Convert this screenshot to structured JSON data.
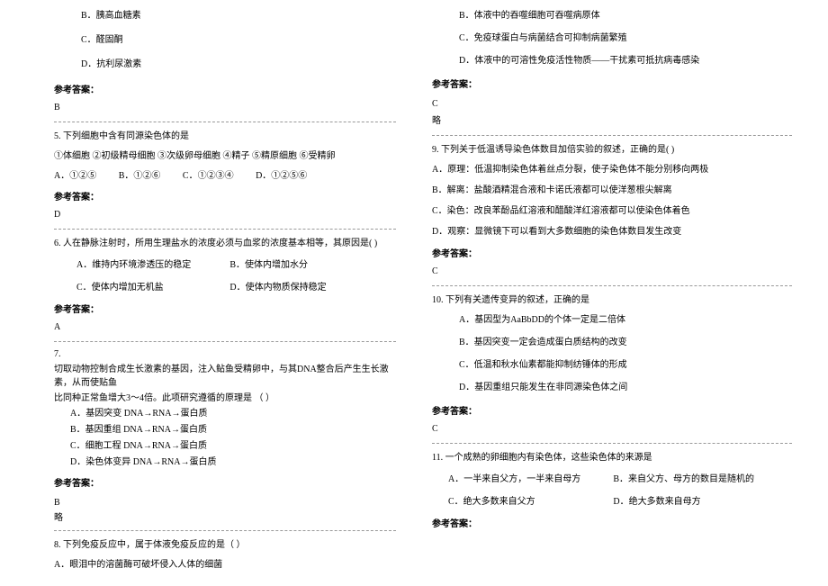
{
  "left": {
    "q4": {
      "optB": "B．胰高血糖素",
      "optC": "C．醛固酮",
      "optD": "D．抗利尿激素",
      "answerLabel": "参考答案：",
      "answer": "B"
    },
    "q5": {
      "stem": "5. 下列细胞中含有同源染色体的是",
      "items": "①体细胞  ②初级精母细胞  ③次级卵母细胞  ④精子  ⑤精原细胞  ⑥受精卵",
      "optA": "A．①②⑤",
      "optB": "B．①②⑥",
      "optC": "C．①②③④",
      "optD": "D．①②⑤⑥",
      "answerLabel": "参考答案：",
      "answer": "D"
    },
    "q6": {
      "stem": "6. 人在静脉注射时，所用生理盐水的浓度必须与血浆的浓度基本相等，其原因是(    )",
      "optA": "A．维持内环境渗透压的稳定",
      "optB": "B．使体内增加水分",
      "optC": "C．使体内增加无机盐",
      "optD": "D．使体内物质保持稳定",
      "answerLabel": "参考答案：",
      "answer": "A"
    },
    "q7": {
      "num": "7.",
      "stem1": "切取动物控制合成生长激素的基因，注入鲇鱼受精卵中，与其DNA整合后产生生长激素，从而使贴鱼",
      "stem2": "比同种正常鱼增大3～4倍。此项研究遵循的原理是                   （      ）",
      "optA": "A．基因突变   DNA→RNA→蛋白质",
      "optB": "B．基因重组   DNA→RNA→蛋白质",
      "optC": "C．细胞工程   DNA→RNA→蛋白质",
      "optD": "D．染色体变异   DNA→RNA→蛋白质",
      "answerLabel": "参考答案：",
      "answer": "B",
      "note": "略"
    },
    "q8": {
      "stem": "8. 下列免疫反应中，属于体液免疫反应的是（  ）",
      "optA": "A．眼泪中的溶菌酶可破坏侵入人体的细菌"
    }
  },
  "right": {
    "q8cont": {
      "optB": "B．体液中的吞噬细胞可吞噬病原体",
      "optC": "C．免疫球蛋白与病菌结合可抑制病菌繁殖",
      "optD": "D．体液中的可溶性免疫活性物质——干扰素可抵抗病毒感染",
      "answerLabel": "参考答案：",
      "answer": "C",
      "note": "略"
    },
    "q9": {
      "stem": "9. 下列关于低温诱导染色体数目加倍实验的叙述，正确的是(    )",
      "optA": "A．原理：低温抑制染色体着丝点分裂，使子染色体不能分别移向两极",
      "optB": "B．解离：盐酸酒精混合液和卡诺氏液都可以使洋葱根尖解离",
      "optC": "C．染色：改良苯酚品红溶液和醋酸洋红溶液都可以使染色体着色",
      "optD": "D．观察：显微镜下可以看到大多数细胞的染色体数目发生改变",
      "answerLabel": "参考答案：",
      "answer": "C"
    },
    "q10": {
      "stem": "10. 下列有关遗传变异的叙述，正确的是",
      "optA": "A．基因型为AaBbDD的个体一定是二倍体",
      "optB": "B．基因突变一定会造成蛋白质结构的改变",
      "optC": "C．低温和秋水仙素都能抑制纺锤体的形成",
      "optD": "D．基因重组只能发生在非同源染色体之间",
      "answerLabel": "参考答案：",
      "answer": "C"
    },
    "q11": {
      "stem": "11. 一个成熟的卵细胞内有染色体，这些染色体的来源是",
      "optA": "A．一半来自父方，一半来自母方",
      "optB": "B．来自父方、母方的数目是随机的",
      "optC": "C．绝大多数来自父方",
      "optD": "D．绝大多数来自母方",
      "answerLabel": "参考答案："
    }
  }
}
